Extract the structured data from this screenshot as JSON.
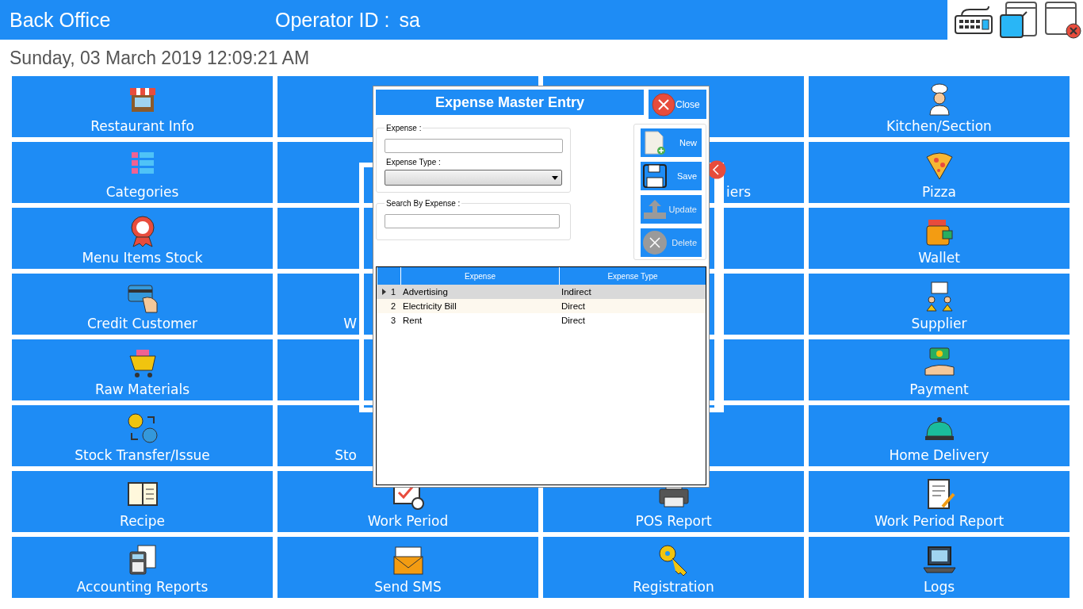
{
  "header": {
    "title": "Back Office",
    "operator_label": "Operator ID :",
    "operator": "sa"
  },
  "date": "Sunday, 03 March 2019 12:09:21 AM",
  "tiles": [
    {
      "kind": "full",
      "label": "Restaurant Info"
    },
    {
      "kind": "covered"
    },
    {
      "kind": "covered"
    },
    {
      "kind": "full",
      "label": "Kitchen/Section"
    },
    {
      "kind": "full",
      "label": "Categories"
    },
    {
      "kind": "covered"
    },
    {
      "kind": "covered-left",
      "label": "iers"
    },
    {
      "kind": "full",
      "label": "Pizza"
    },
    {
      "kind": "full",
      "label": "Menu Items Stock"
    },
    {
      "kind": "covered"
    },
    {
      "kind": "covered"
    },
    {
      "kind": "full",
      "label": "Wallet"
    },
    {
      "kind": "full",
      "label": "Credit Customer"
    },
    {
      "kind": "covered-right",
      "label": "W"
    },
    {
      "kind": "covered"
    },
    {
      "kind": "full",
      "label": "Supplier"
    },
    {
      "kind": "full",
      "label": "Raw Materials"
    },
    {
      "kind": "covered"
    },
    {
      "kind": "covered"
    },
    {
      "kind": "full",
      "label": "Payment"
    },
    {
      "kind": "full",
      "label": "Stock Transfer/Issue"
    },
    {
      "kind": "covered-right",
      "label": "Sto"
    },
    {
      "kind": "covered"
    },
    {
      "kind": "full",
      "label": "Home Delivery"
    },
    {
      "kind": "full",
      "label": "Recipe"
    },
    {
      "kind": "full",
      "label": "Work Period"
    },
    {
      "kind": "full",
      "label": "POS Report"
    },
    {
      "kind": "full",
      "label": "Work Period Report"
    },
    {
      "kind": "full",
      "label": "Accounting Reports"
    },
    {
      "kind": "full",
      "label": "Send SMS"
    },
    {
      "kind": "full",
      "label": "Registration"
    },
    {
      "kind": "full",
      "label": "Logs"
    }
  ],
  "dialog": {
    "title": "Expense Master Entry",
    "close": "Close",
    "expense_label": "Expense :",
    "type_label": "Expense Type :",
    "search_label": "Search By Expense :",
    "buttons": [
      {
        "label": "New",
        "disabled": false
      },
      {
        "label": "Save",
        "disabled": false
      },
      {
        "label": "Update",
        "disabled": true
      },
      {
        "label": "Delete",
        "disabled": true
      }
    ],
    "table": {
      "columns": [
        "Expense",
        "Expense Type"
      ],
      "rows": [
        {
          "number": "1",
          "expense": "Advertising",
          "type": "Indirect",
          "selected": true
        },
        {
          "number": "2",
          "expense": "Electricity Bill",
          "type": "Direct",
          "selected": false
        },
        {
          "number": "3",
          "expense": "Rent",
          "type": "Direct",
          "selected": false
        }
      ]
    }
  }
}
